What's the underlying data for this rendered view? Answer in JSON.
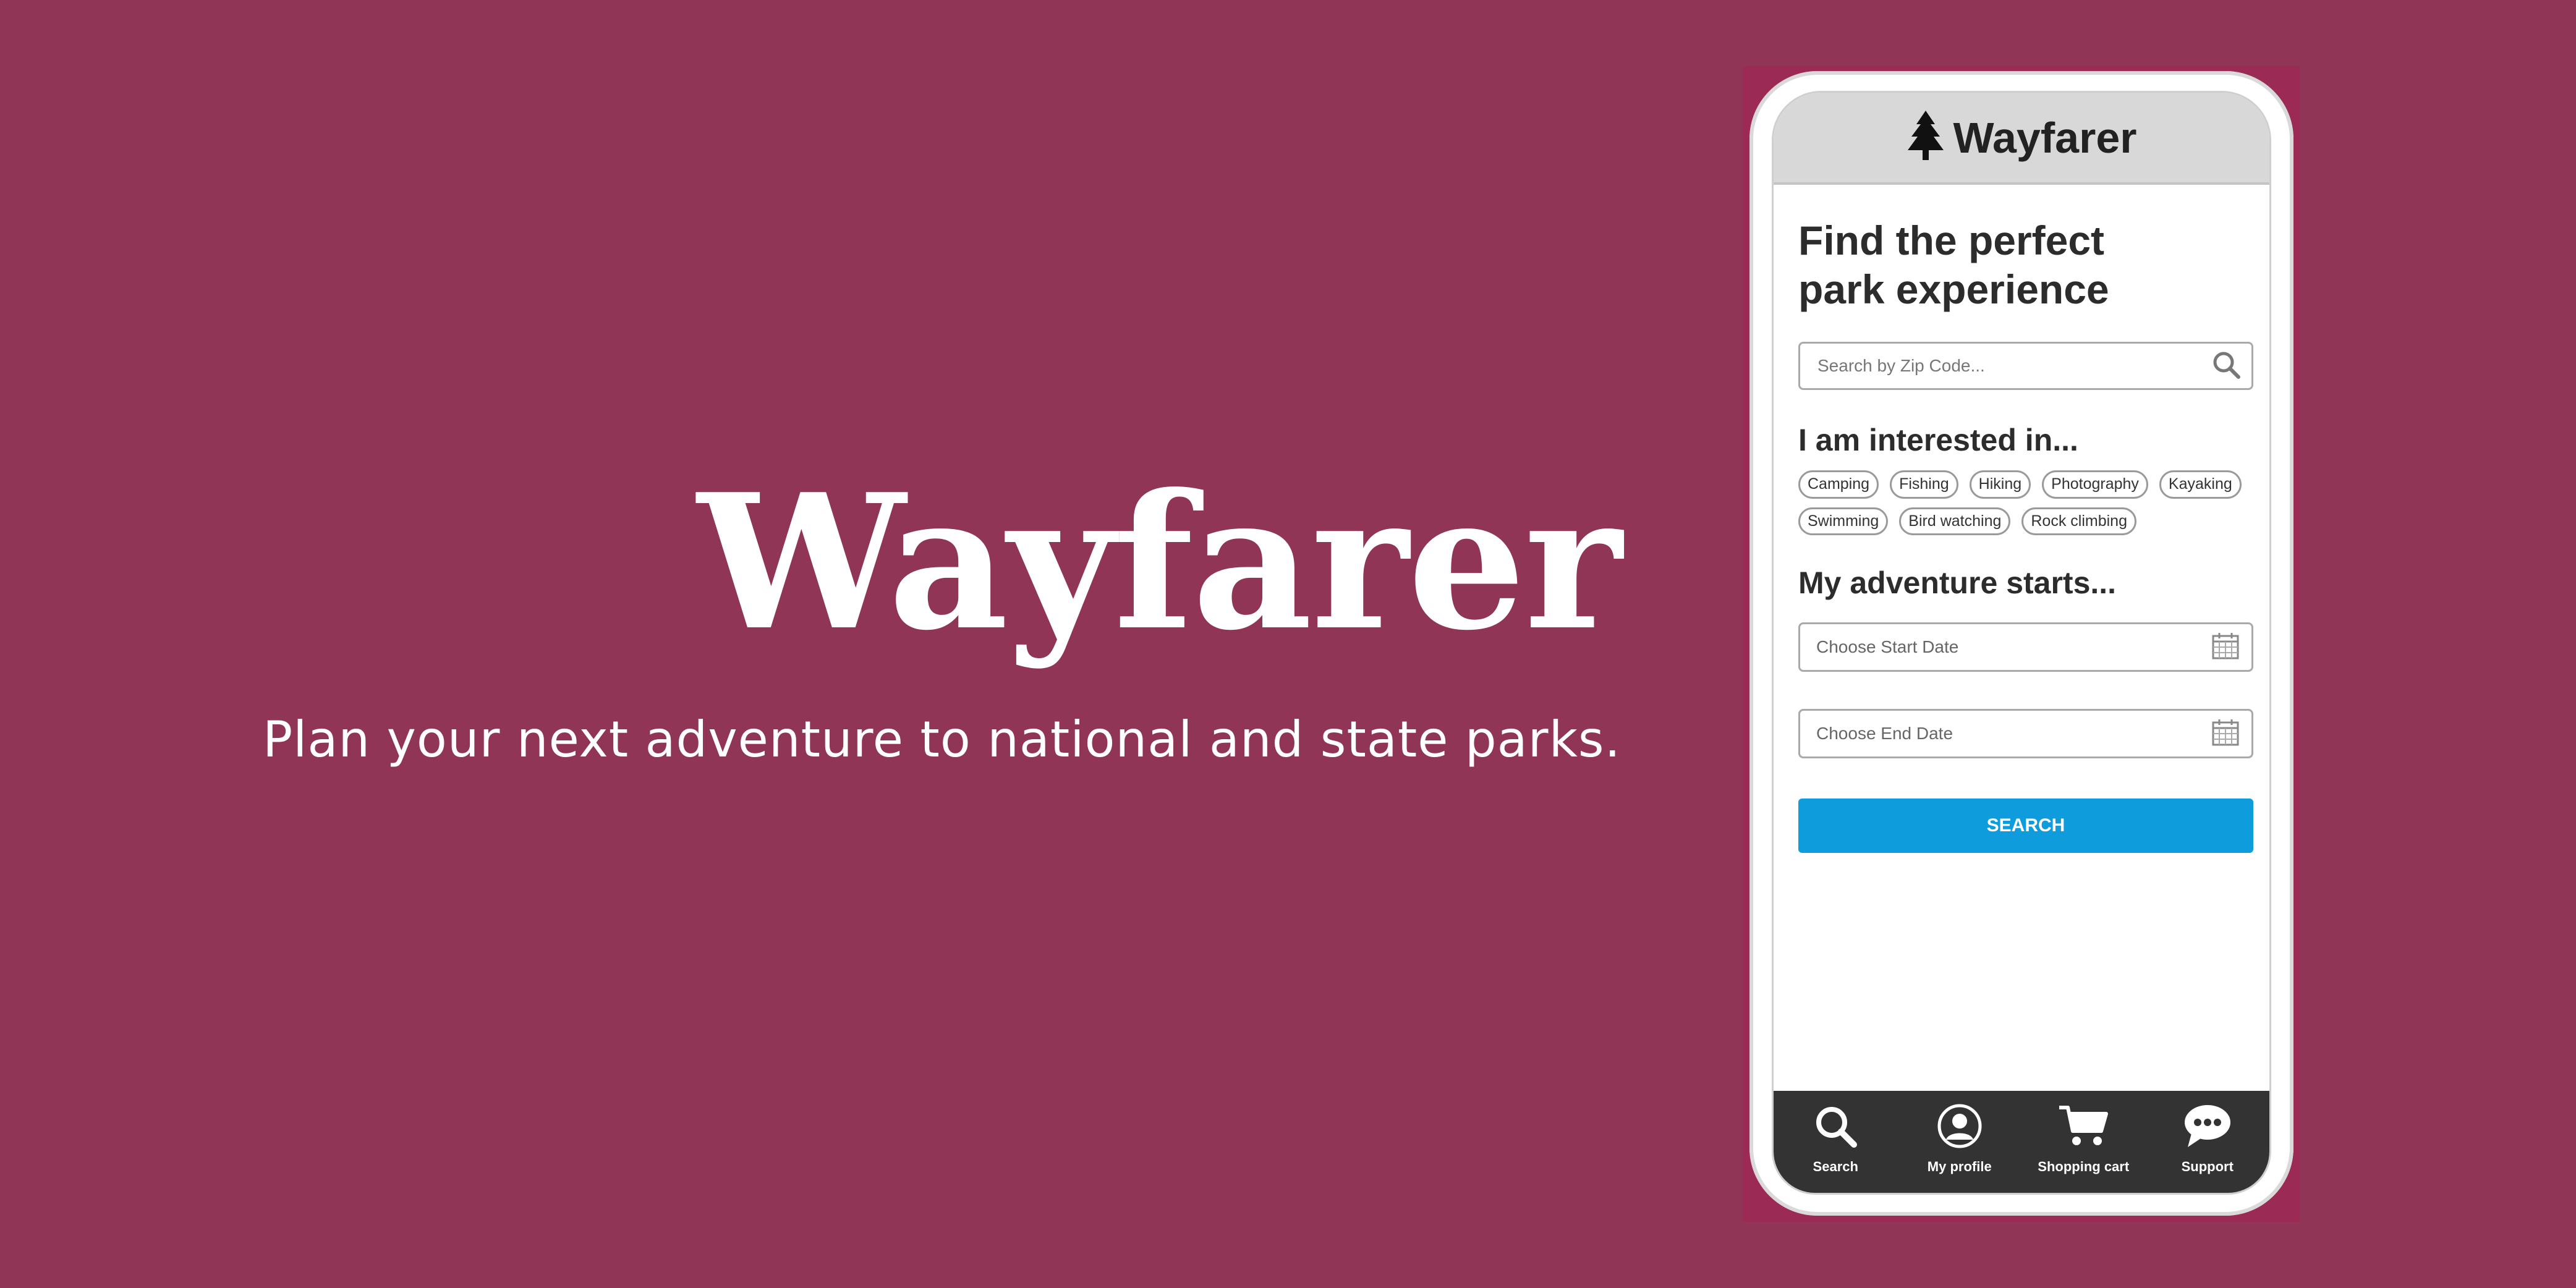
{
  "hero": {
    "title": "Wayfarer",
    "subtitle": "Plan your next adventure to national and state parks."
  },
  "app": {
    "brand": "Wayfarer",
    "headline_line1": "Find the perfect",
    "headline_line2": "park experience",
    "search_placeholder": "Search by Zip Code...",
    "interests_title": "I am interested in...",
    "interests": [
      "Camping",
      "Fishing",
      "Hiking",
      "Photography",
      "Kayaking",
      "Swimming",
      "Bird watching",
      "Rock climbing"
    ],
    "dates_title": "My adventure starts...",
    "start_date_placeholder": "Choose Start Date",
    "end_date_placeholder": "Choose End Date",
    "search_button": "SEARCH"
  },
  "tabbar": {
    "items": [
      {
        "label": "Search",
        "icon": "search-icon"
      },
      {
        "label": "My profile",
        "icon": "profile-icon"
      },
      {
        "label": "Shopping cart",
        "icon": "cart-icon"
      },
      {
        "label": "Support",
        "icon": "chat-icon"
      }
    ]
  },
  "colors": {
    "background": "#913556",
    "button": "#0f9cdc",
    "tabbar": "#333333",
    "header": "#d8d8d8"
  }
}
